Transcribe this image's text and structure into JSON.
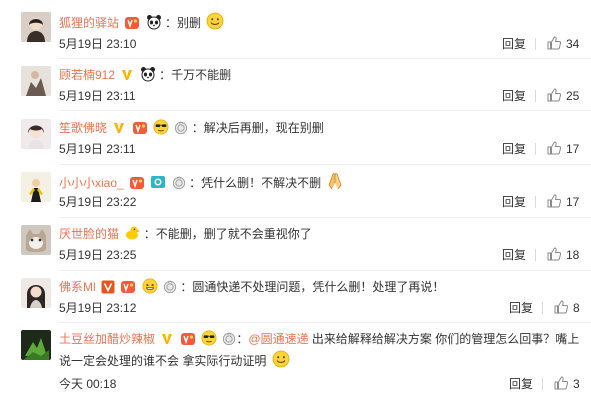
{
  "comments": [
    {
      "username": "狐狸的驿站",
      "text": "：别删",
      "badges": [
        "vip-icon",
        "panda-icon"
      ],
      "trailing_emoji": "smile-emoji-icon",
      "date": "5月19日 23:10",
      "reply_label": "回复",
      "likes": "34"
    },
    {
      "username": "顾若楠912",
      "text": "：千万不能删",
      "badges": [
        "v-verified-icon",
        "panda-icon"
      ],
      "date": "5月19日 23:11",
      "reply_label": "回复",
      "likes": "25"
    },
    {
      "username": "笙歌佛晓",
      "text": "：解决后再删，现在别删",
      "badges": [
        "v-verified-icon",
        "vip-icon",
        "sunglasses-emoji-icon",
        "medal-icon"
      ],
      "date": "5月19日 23:11",
      "reply_label": "回复",
      "likes": "17"
    },
    {
      "username": "小小小xiao_",
      "text": "：凭什么删！不解决不删",
      "badges": [
        "vip-icon",
        "camera-icon",
        "medal-icon"
      ],
      "trailing_emoji": "pray-hands-emoji-icon",
      "date": "5月19日 23:22",
      "reply_label": "回复",
      "likes": "17"
    },
    {
      "username": "厌世脸的猫",
      "text": "：不能删，删了就不会重视你了",
      "badges": [
        "duck-icon"
      ],
      "date": "5月19日 23:25",
      "reply_label": "回复",
      "likes": "18"
    },
    {
      "username": "佛系Ml",
      "text": "：圆通快递不处理问题，凭什么删！处理了再说！",
      "badges": [
        "v-red-icon",
        "vip-icon",
        "grin-emoji-icon",
        "medal-icon"
      ],
      "date": "5月19日 23:12",
      "reply_label": "回复",
      "likes": "8"
    },
    {
      "username": "土豆丝加醋炒辣椒",
      "text_mention": "@圆通速递",
      "text_rest": " 出来给解释给解决方案 你们的管理怎么回事？嘴上",
      "text_line2": "说一定会处理的谁不会 拿实际行动证明",
      "badges": [
        "v-verified-icon",
        "vip-icon",
        "sunglasses-emoji-icon",
        "medal-icon"
      ],
      "trailing_emoji": "smile-emoji-icon",
      "date": "今天 00:18",
      "reply_label": "回复",
      "likes": "3"
    }
  ],
  "colors": {
    "username": "#eb7350",
    "text": "#333333",
    "divider": "#f0f0f0"
  }
}
